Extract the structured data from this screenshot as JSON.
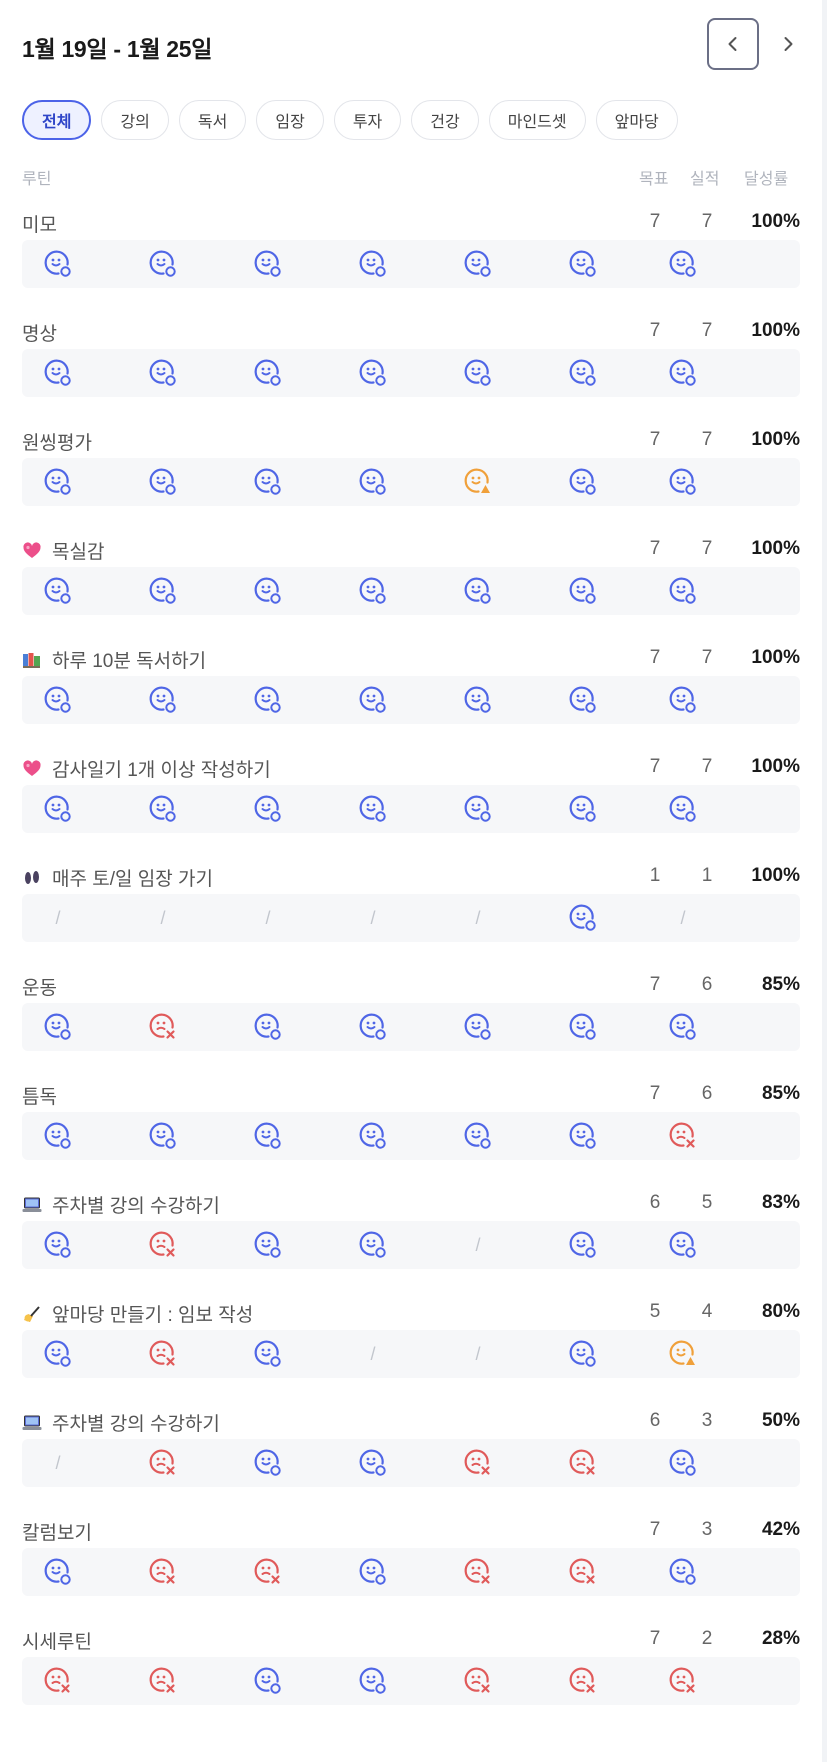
{
  "header": {
    "title": "1월 19일 - 1월 25일"
  },
  "filters": [
    "전체",
    "강의",
    "독서",
    "임장",
    "투자",
    "건강",
    "마인드셋",
    "앞마당"
  ],
  "columns": {
    "routine": "루틴",
    "goal": "목표",
    "actual": "실적",
    "rate": "달성률"
  },
  "colors": {
    "accent": "#4c63e8",
    "success": "#4f66e6",
    "fail": "#e05a5a",
    "partial": "#f0a03a",
    "slash": "#c2c6cd"
  },
  "routines": [
    {
      "name": "미모",
      "icon": "",
      "goal": "7",
      "actual": "7",
      "rate": "100%",
      "days": [
        "success",
        "success",
        "success",
        "success",
        "success",
        "success",
        "success"
      ]
    },
    {
      "name": "명상",
      "icon": "",
      "goal": "7",
      "actual": "7",
      "rate": "100%",
      "days": [
        "success",
        "success",
        "success",
        "success",
        "success",
        "success",
        "success"
      ]
    },
    {
      "name": "원씽평가",
      "icon": "",
      "goal": "7",
      "actual": "7",
      "rate": "100%",
      "days": [
        "success",
        "success",
        "success",
        "success",
        "partial",
        "success",
        "success"
      ]
    },
    {
      "name": "목실감",
      "icon": "heart",
      "goal": "7",
      "actual": "7",
      "rate": "100%",
      "days": [
        "success",
        "success",
        "success",
        "success",
        "success",
        "success",
        "success"
      ]
    },
    {
      "name": "하루 10분 독서하기",
      "icon": "books",
      "goal": "7",
      "actual": "7",
      "rate": "100%",
      "days": [
        "success",
        "success",
        "success",
        "success",
        "success",
        "success",
        "success"
      ]
    },
    {
      "name": "감사일기 1개 이상 작성하기",
      "icon": "heart",
      "goal": "7",
      "actual": "7",
      "rate": "100%",
      "days": [
        "success",
        "success",
        "success",
        "success",
        "success",
        "success",
        "success"
      ]
    },
    {
      "name": "매주 토/일 임장 가기",
      "icon": "footprints",
      "goal": "1",
      "actual": "1",
      "rate": "100%",
      "days": [
        "none",
        "none",
        "none",
        "none",
        "none",
        "success",
        "none"
      ]
    },
    {
      "name": "운동",
      "icon": "",
      "goal": "7",
      "actual": "6",
      "rate": "85%",
      "days": [
        "success",
        "fail",
        "success",
        "success",
        "success",
        "success",
        "success"
      ]
    },
    {
      "name": "틈독",
      "icon": "",
      "goal": "7",
      "actual": "6",
      "rate": "85%",
      "days": [
        "success",
        "success",
        "success",
        "success",
        "success",
        "success",
        "fail"
      ]
    },
    {
      "name": "주차별 강의 수강하기",
      "icon": "laptop",
      "goal": "6",
      "actual": "5",
      "rate": "83%",
      "days": [
        "success",
        "fail",
        "success",
        "success",
        "none",
        "success",
        "success"
      ]
    },
    {
      "name": "앞마당 만들기 : 임보 작성",
      "icon": "writing",
      "goal": "5",
      "actual": "4",
      "rate": "80%",
      "days": [
        "success",
        "fail",
        "success",
        "none",
        "none",
        "success",
        "partial"
      ]
    },
    {
      "name": "주차별 강의 수강하기",
      "icon": "laptop",
      "goal": "6",
      "actual": "3",
      "rate": "50%",
      "days": [
        "none",
        "fail",
        "success",
        "success",
        "fail",
        "fail",
        "success"
      ]
    },
    {
      "name": "칼럼보기",
      "icon": "",
      "goal": "7",
      "actual": "3",
      "rate": "42%",
      "days": [
        "success",
        "fail",
        "fail",
        "success",
        "fail",
        "fail",
        "success"
      ]
    },
    {
      "name": "시세루틴",
      "icon": "",
      "goal": "7",
      "actual": "2",
      "rate": "28%",
      "days": [
        "fail",
        "fail",
        "success",
        "success",
        "fail",
        "fail",
        "fail"
      ]
    }
  ],
  "slash_text": "/"
}
